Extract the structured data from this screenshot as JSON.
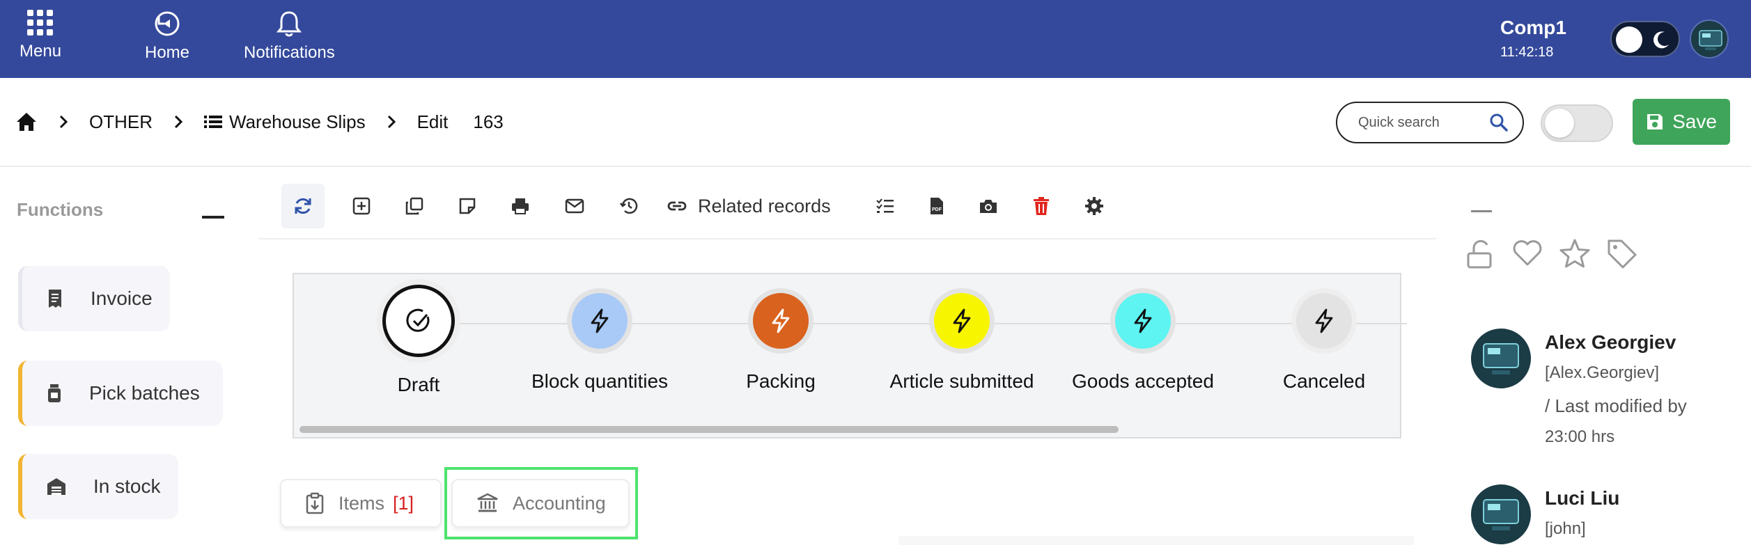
{
  "topbar": {
    "menu_label": "Menu",
    "home_label": "Home",
    "notifications_label": "Notifications",
    "company": "Comp1",
    "time": "11:42:18",
    "bg_color": "#34499b"
  },
  "breadcrumb": {
    "home_icon": "home-icon",
    "item1": "OTHER",
    "item2": "Warehouse Slips",
    "item3": "Edit",
    "record_number": "163"
  },
  "search": {
    "placeholder": "Quick search"
  },
  "save": {
    "label": "Save",
    "color": "#3fa55a"
  },
  "functions": {
    "title": "Functions",
    "items": [
      {
        "label": "Invoice",
        "icon": "receipt-icon"
      },
      {
        "label": "Pick batches",
        "icon": "jar-icon"
      },
      {
        "label": "In stock",
        "icon": "warehouse-icon"
      }
    ],
    "accent_color": "#f2b533"
  },
  "toolbar": {
    "related_records_label": "Related records",
    "icons": [
      "refresh-icon",
      "add-square-icon",
      "copy-icon",
      "note-icon",
      "print-icon",
      "mail-icon",
      "history-icon",
      "link-icon",
      "checklist-icon",
      "pdf-icon",
      "camera-icon",
      "trash-icon",
      "gear-icon"
    ]
  },
  "workflow": {
    "steps": [
      {
        "label": "Draft",
        "color": "#ffffff",
        "state": "current"
      },
      {
        "label": "Block quantities",
        "color": "#a9c9f7"
      },
      {
        "label": "Packing",
        "color": "#d9621e"
      },
      {
        "label": "Article submitted",
        "color": "#f8f500"
      },
      {
        "label": "Goods accepted",
        "color": "#5df4f2"
      },
      {
        "label": "Canceled",
        "color": "#e3e3e3"
      }
    ]
  },
  "tabs": [
    {
      "label": "Items",
      "count": "[1]"
    },
    {
      "label": "Accounting",
      "count": ""
    }
  ],
  "right_panel": {
    "icons": [
      "unlock-icon",
      "heart-icon",
      "star-icon",
      "tag-icon"
    ],
    "people": [
      {
        "name": "Alex Georgiev",
        "username": "[Alex.Georgiev]",
        "meta": "/ Last modified by",
        "hours": "23:00 hrs"
      },
      {
        "name": "Luci Liu",
        "username": "[john]"
      }
    ]
  }
}
